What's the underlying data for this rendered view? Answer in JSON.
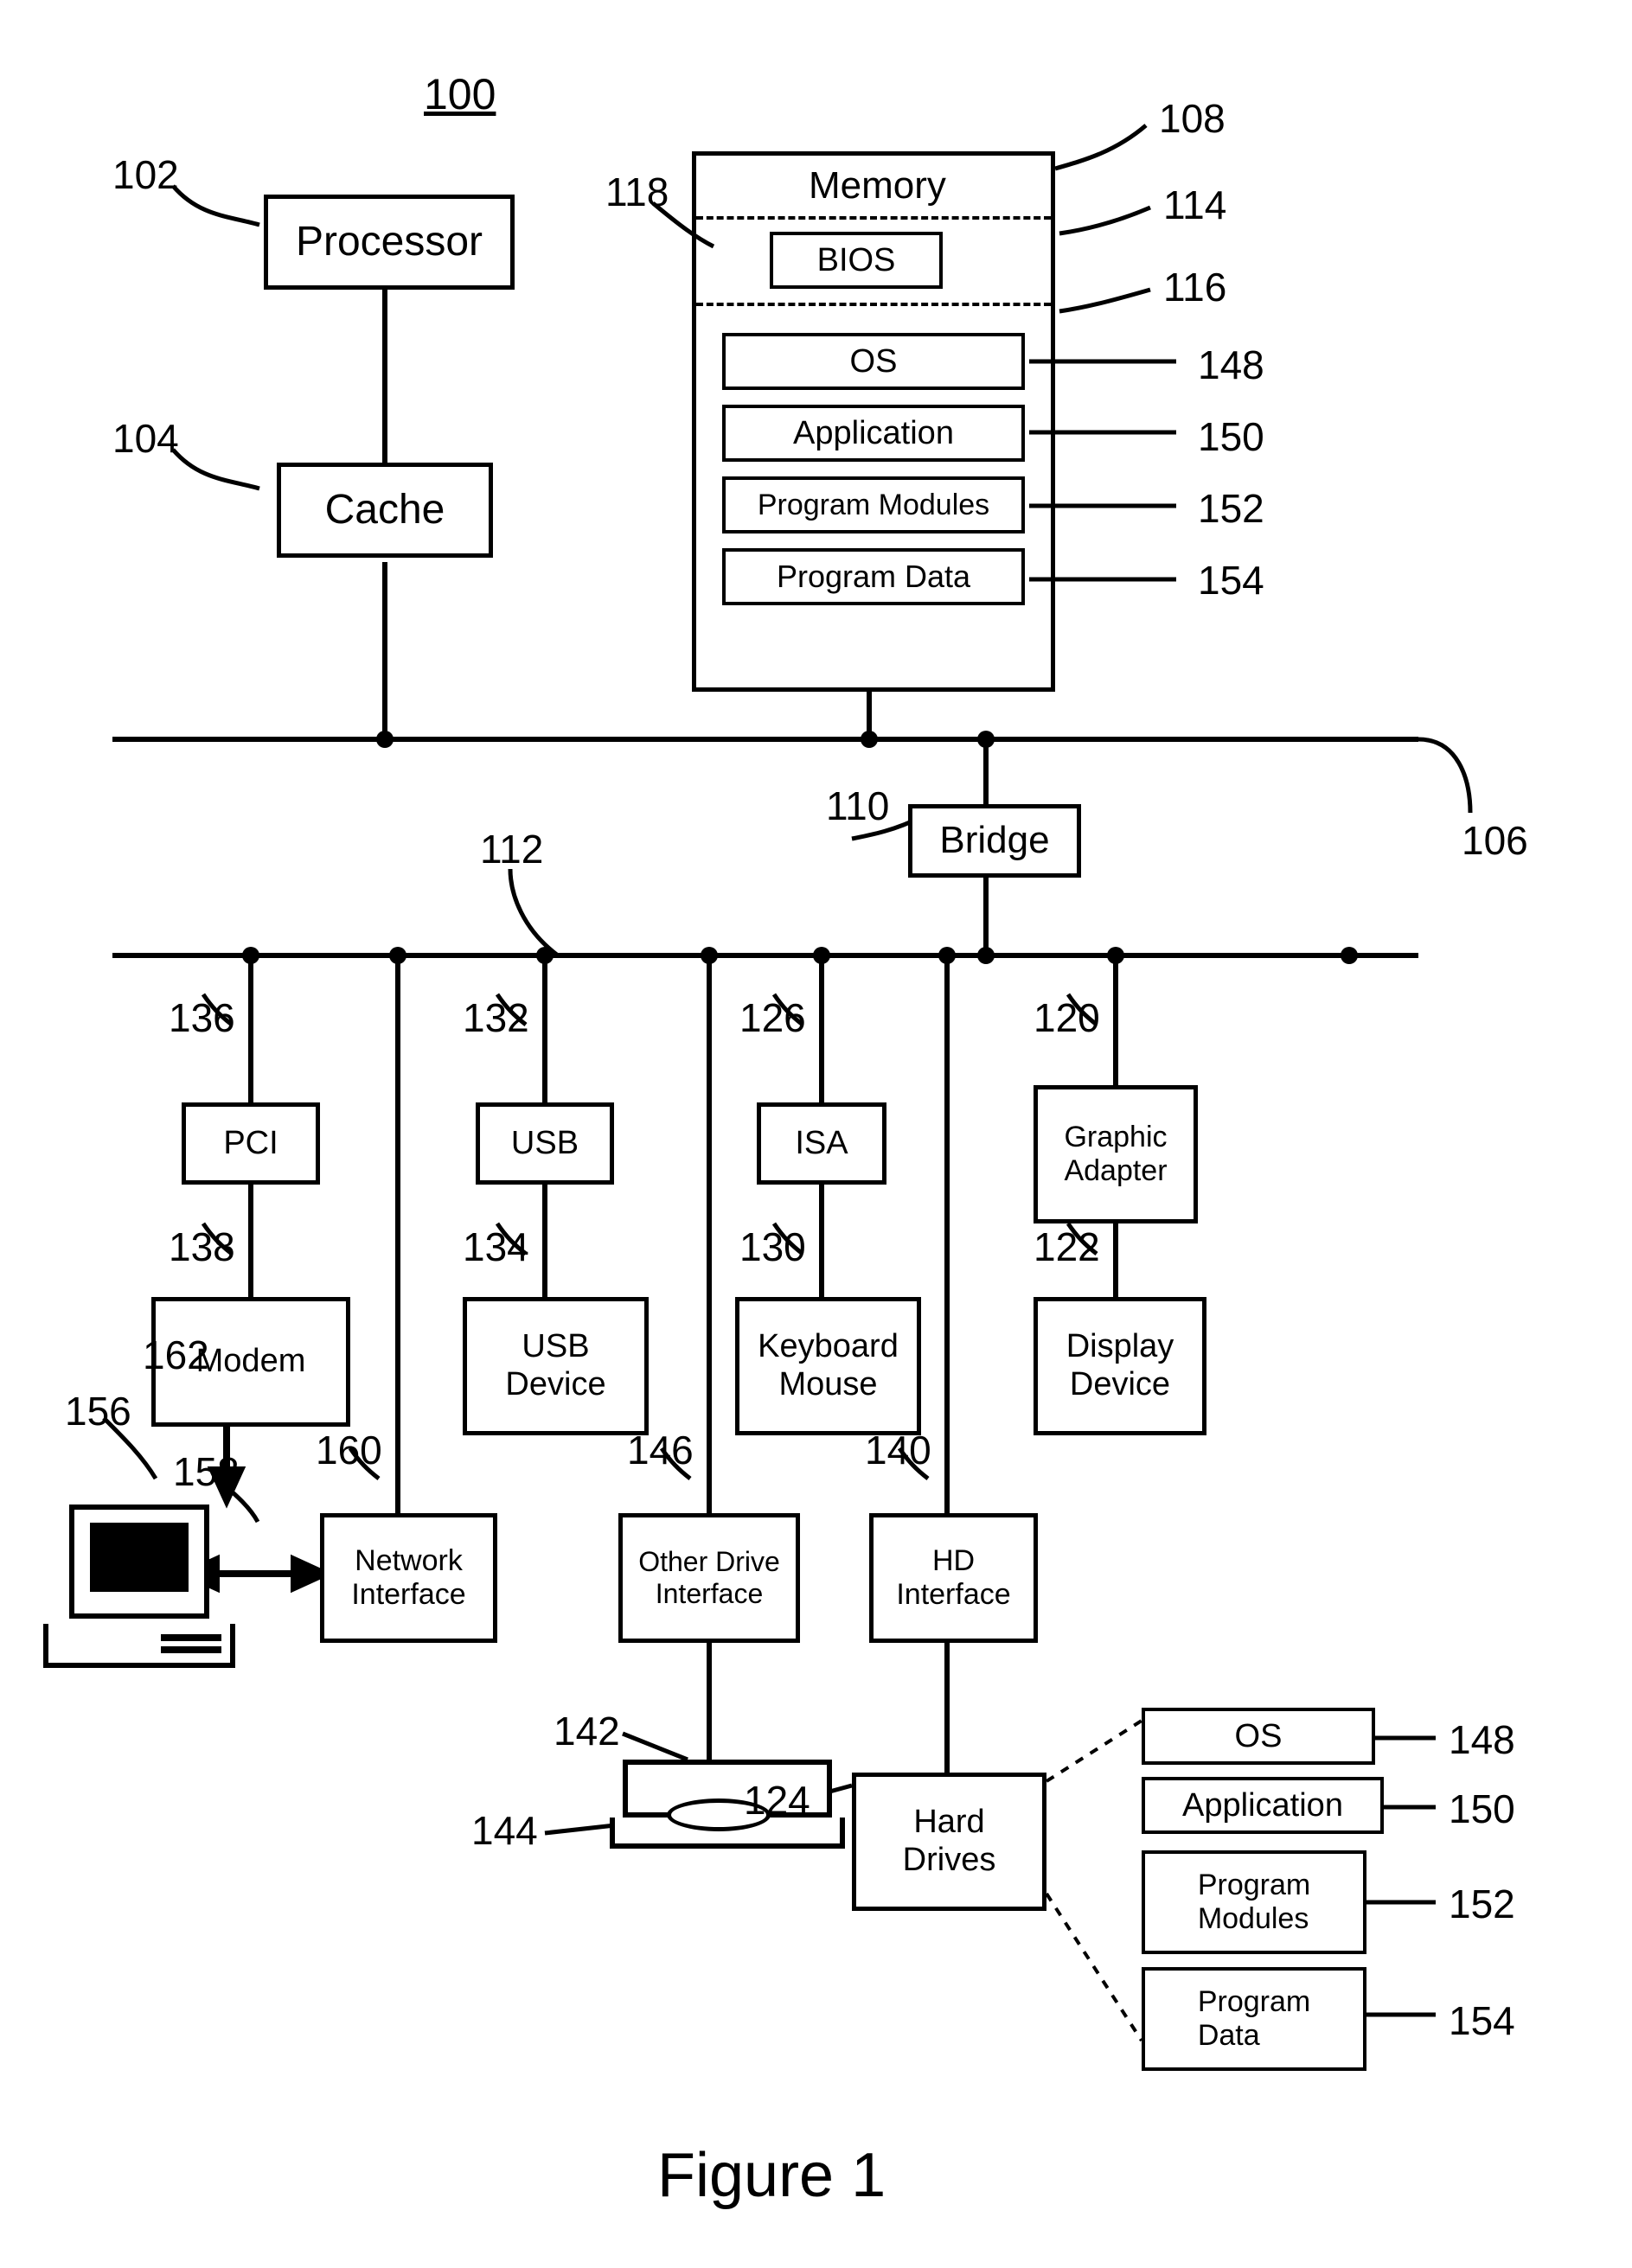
{
  "figure_ref": "100",
  "figure_title": "Figure 1",
  "refs": {
    "r102": "102",
    "r104": "104",
    "r106": "106",
    "r108": "108",
    "r110": "110",
    "r112": "112",
    "r114": "114",
    "r116": "116",
    "r118": "118",
    "r120": "120",
    "r122": "122",
    "r124": "124",
    "r126": "126",
    "r130": "130",
    "r132": "132",
    "r134": "134",
    "r136": "136",
    "r138": "138",
    "r140": "140",
    "r142": "142",
    "r144": "144",
    "r146": "146",
    "r148": "148",
    "r150": "150",
    "r152": "152",
    "r154": "154",
    "r156": "156",
    "r158": "158",
    "r160": "160",
    "r162": "162"
  },
  "blocks": {
    "processor": "Processor",
    "cache": "Cache",
    "memory_title": "Memory",
    "bios": "BIOS",
    "os": "OS",
    "application": "Application",
    "program_modules": "Program Modules",
    "program_data": "Program Data",
    "bridge": "Bridge",
    "pci": "PCI",
    "modem": "Modem",
    "usb": "USB",
    "usb_device": "USB\nDevice",
    "isa": "ISA",
    "keyboard_mouse": "Keyboard\nMouse",
    "graphic_adapter": "Graphic\nAdapter",
    "display_device": "Display\nDevice",
    "network_interface": "Network\nInterface",
    "other_drive_interface": "Other Drive\nInterface",
    "hd_interface": "HD\nInterface",
    "hard_drives": "Hard\nDrives",
    "hd_os": "OS",
    "hd_application": "Application",
    "hd_program_modules": "Program\nModules",
    "hd_program_data": "Program\nData"
  }
}
